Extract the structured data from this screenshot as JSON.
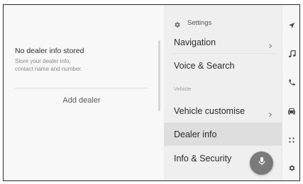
{
  "dealer_panel": {
    "title": "No dealer info stored",
    "description_line1": "Store your dealer info,",
    "description_line2": "contact name and number.",
    "add_button_label": "Add dealer"
  },
  "settings_menu": {
    "header_title": "Settings",
    "items": [
      {
        "label": "Navigation",
        "has_chevron": true
      },
      {
        "label": "Voice & Search",
        "has_chevron": false
      },
      {
        "label": "Vehicle customise",
        "has_chevron": true
      },
      {
        "label": "Dealer info",
        "has_chevron": false,
        "selected": true
      },
      {
        "label": "Info & Security",
        "has_chevron": false
      }
    ],
    "section_label": "Vehicle"
  },
  "icon_strip": [
    {
      "icon": "navigation-arrow-icon"
    },
    {
      "icon": "music-note-icon"
    },
    {
      "icon": "phone-icon"
    },
    {
      "icon": "car-icon"
    },
    {
      "icon": "apps-grid-icon"
    },
    {
      "icon": "settings-gear-icon"
    }
  ],
  "voice_button": {
    "icon": "microphone-icon"
  },
  "colors": {
    "accent_active_bg": "#dedede",
    "menu_bg": "#efefef",
    "mic_button": "#7a7a7a"
  }
}
